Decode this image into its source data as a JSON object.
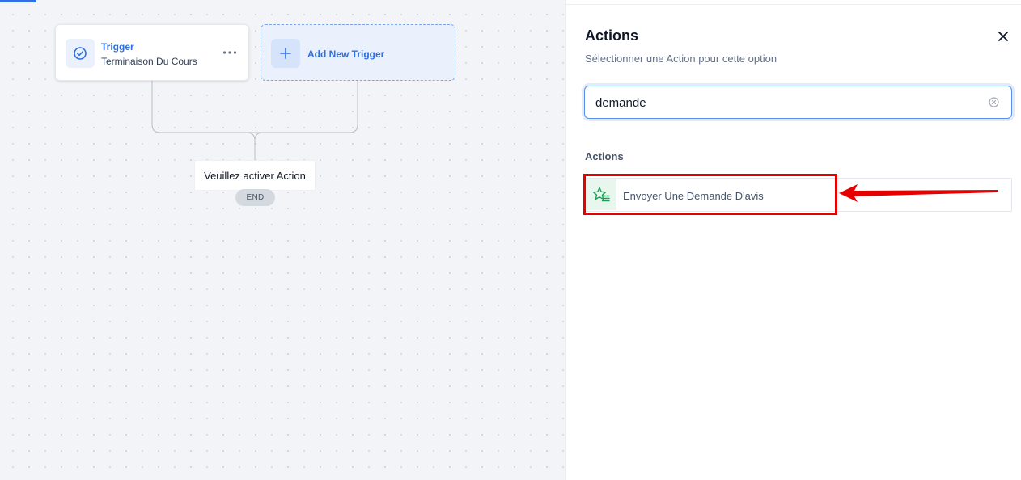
{
  "canvas": {
    "trigger_card": {
      "title": "Trigger",
      "subtitle": "Terminaison Du Cours",
      "icon": "check-circle-icon",
      "more_icon": "more-horizontal-icon"
    },
    "add_trigger": {
      "label": "Add New Trigger",
      "icon": "plus-icon"
    },
    "action_placeholder": "Veuillez activer Action",
    "end_label": "END"
  },
  "panel": {
    "title": "Actions",
    "subtitle": "Sélectionner une Action pour cette option",
    "close_icon": "close-icon",
    "search": {
      "value": "demande",
      "placeholder": "",
      "clear_icon": "clear-circle-icon"
    },
    "section_label": "Actions",
    "actions": [
      {
        "label": "Envoyer Une Demande D'avis",
        "icon": "star-list-icon"
      }
    ]
  },
  "colors": {
    "accent": "#2f6fe4",
    "highlight": "#e60000",
    "action_icon_green": "#1f9d55"
  }
}
